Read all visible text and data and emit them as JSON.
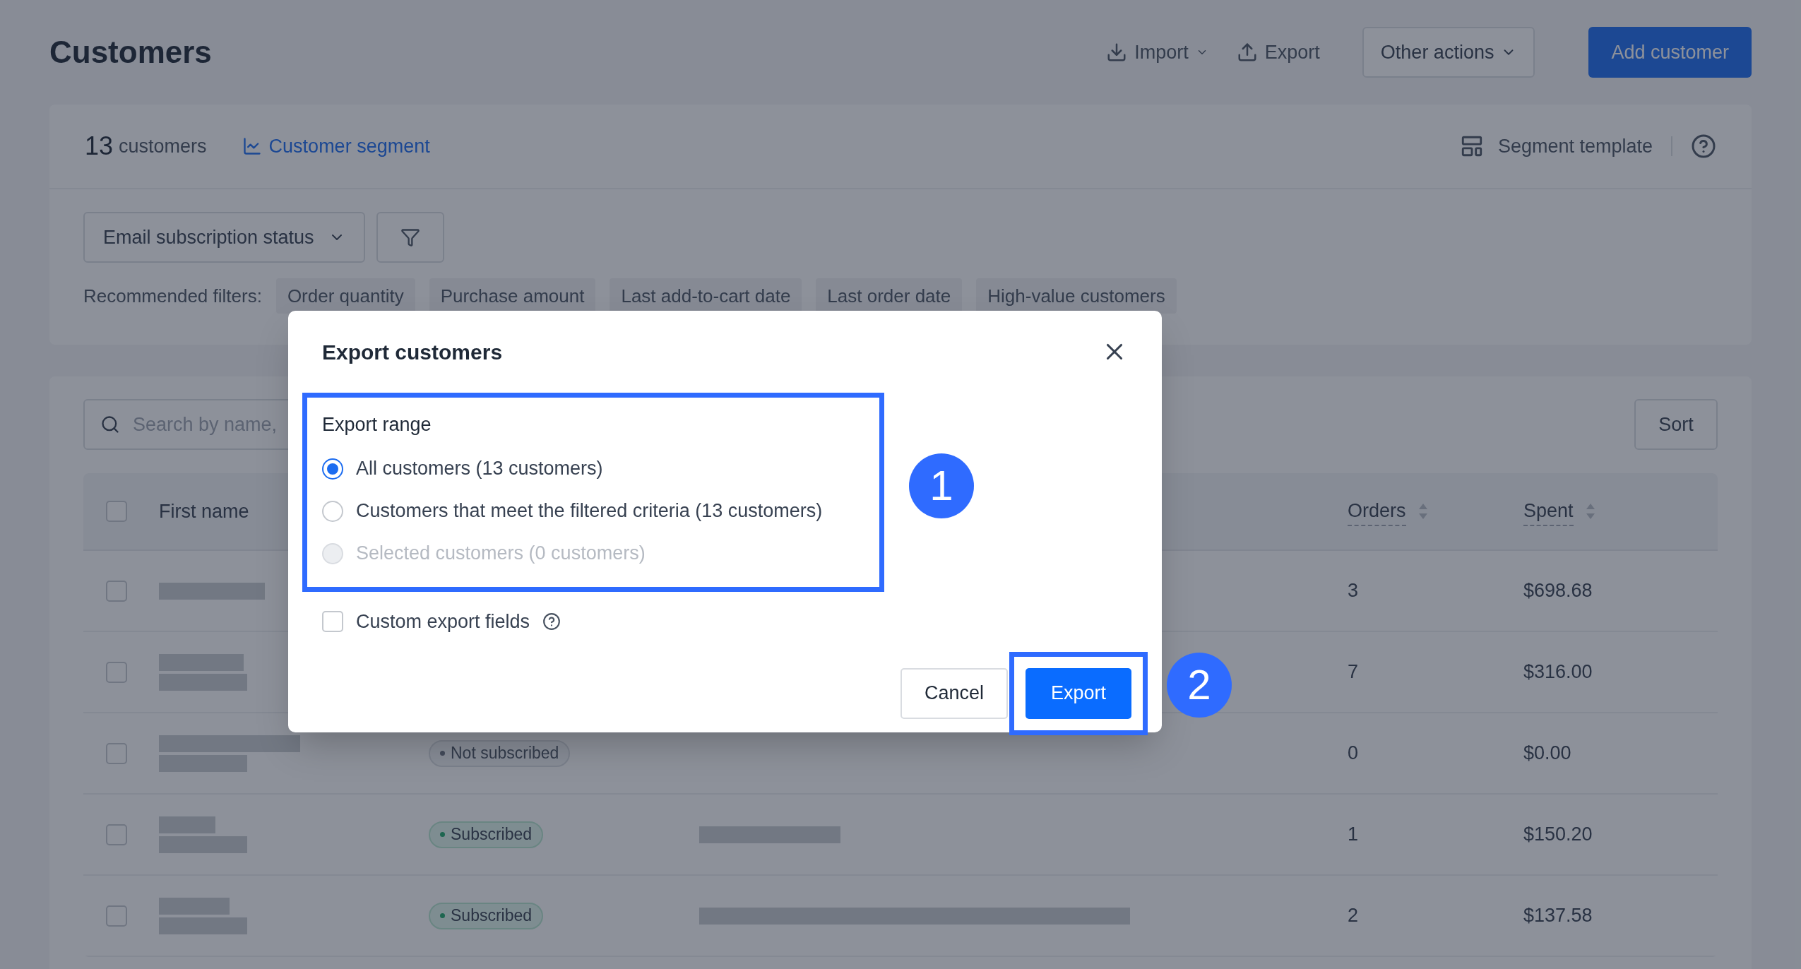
{
  "page": {
    "title": "Customers"
  },
  "header_actions": [
    {
      "kind": "menu",
      "label": "Import"
    },
    {
      "kind": "plain",
      "label": "Export"
    },
    {
      "kind": "dropdown",
      "label": "Other actions"
    },
    {
      "kind": "primary",
      "label": "Add customer"
    }
  ],
  "summary": {
    "count": "13",
    "count_label": "customers",
    "segment_link": "Customer segment",
    "template": "Segment template"
  },
  "filters": {
    "dropdown": "Email subscription status",
    "recommended_label": "Recommended filters:",
    "chips": [
      "Order quantity",
      "Purchase amount",
      "Last add-to-cart date",
      "Last order date",
      "High-value customers"
    ]
  },
  "search": {
    "placeholder": "Search by name,"
  },
  "sort_button": "Sort",
  "table": {
    "select_all_checked": false,
    "columns": [
      {
        "label": "First name",
        "sortable": false
      },
      {
        "label": "Orders",
        "sortable": true
      },
      {
        "label": "Spent",
        "sortable": true
      }
    ],
    "rows": [
      {
        "checked": false,
        "orders": "3",
        "spent": "$698.68"
      },
      {
        "checked": false,
        "orders": "7",
        "spent": "$316.00"
      },
      {
        "checked": false,
        "status": {
          "kind": "not_subscribed",
          "label": "Not subscribed"
        },
        "orders": "0",
        "spent": "$0.00"
      },
      {
        "checked": false,
        "status": {
          "kind": "subscribed",
          "label": "Subscribed"
        },
        "orders": "1",
        "spent": "$150.20"
      },
      {
        "checked": false,
        "status": {
          "kind": "subscribed",
          "label": "Subscribed"
        },
        "orders": "2",
        "spent": "$137.58"
      }
    ]
  },
  "dialog": {
    "title": "Export customers",
    "range_label": "Export range",
    "options": [
      {
        "label": "All customers (13 customers)",
        "selected": true,
        "disabled": false
      },
      {
        "label": "Customers that meet the filtered criteria (13 customers)",
        "selected": false,
        "disabled": false
      },
      {
        "label": "Selected customers (0 customers)",
        "selected": false,
        "disabled": true
      }
    ],
    "custom_fields": {
      "label": "Custom export fields",
      "checked": false
    },
    "buttons": [
      {
        "kind": "secondary",
        "label": "Cancel"
      },
      {
        "kind": "primary",
        "label": "Export"
      }
    ]
  },
  "callouts": [
    "1",
    "2"
  ]
}
